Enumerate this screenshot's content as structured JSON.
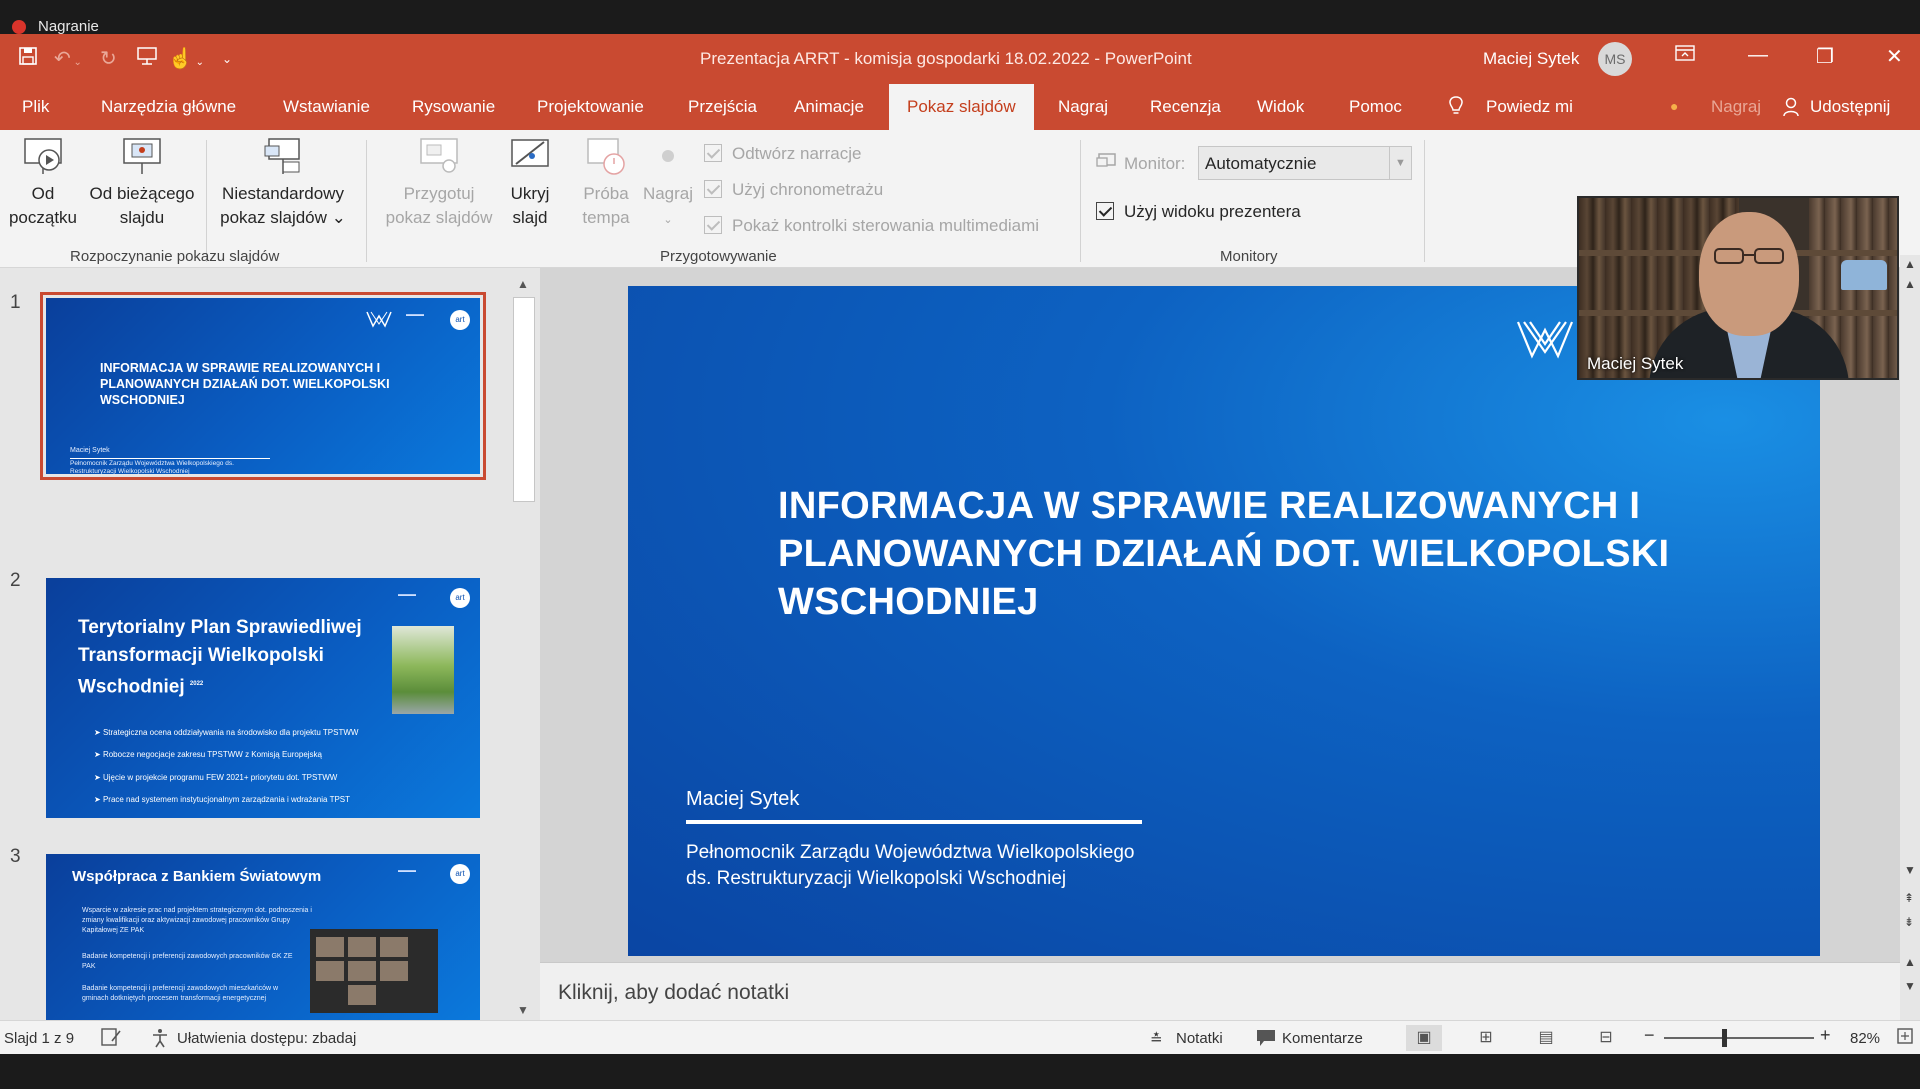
{
  "recording": {
    "label": "Nagranie"
  },
  "window": {
    "title": "Prezentacja ARRT - komisja gospodarki 18.02.2022  -  PowerPoint",
    "user_name": "Maciej Sytek",
    "user_initials": "MS"
  },
  "tabs": [
    {
      "label": "Plik"
    },
    {
      "label": "Narzędzia główne"
    },
    {
      "label": "Wstawianie"
    },
    {
      "label": "Rysowanie"
    },
    {
      "label": "Projektowanie"
    },
    {
      "label": "Przejścia"
    },
    {
      "label": "Animacje"
    },
    {
      "label": "Pokaz slajdów",
      "active": true
    },
    {
      "label": "Nagraj"
    },
    {
      "label": "Recenzja"
    },
    {
      "label": "Widok"
    },
    {
      "label": "Pomoc"
    }
  ],
  "tell_me": "Powiedz mi",
  "tab_right": {
    "record": "Nagraj",
    "share": "Udostępnij"
  },
  "ribbon": {
    "start_group": {
      "label": "Rozpoczynanie pokazu slajdów",
      "from_beginning": [
        "Od",
        "początku"
      ],
      "from_current": [
        "Od bieżącego",
        "slajdu"
      ],
      "custom": [
        "Niestandardowy",
        "pokaz slajdów ⌄"
      ]
    },
    "setup_group": {
      "label": "Przygotowywanie",
      "setup_show": [
        "Przygotuj",
        "pokaz slajdów"
      ],
      "hide_slide": [
        "Ukryj",
        "slajd"
      ],
      "rehearse": [
        "Próba",
        "tempa"
      ],
      "record": [
        "Nagraj",
        "⌄"
      ],
      "checks": [
        "Odtwórz narracje",
        "Użyj chronometrażu",
        "Pokaż kontrolki sterowania multimediami"
      ]
    },
    "monitors_group": {
      "label": "Monitory",
      "monitor_label": "Monitor:",
      "monitor_value": "Automatycznie",
      "presenter_view": "Użyj widoku prezentera"
    }
  },
  "thumbnails": [
    {
      "number": "1",
      "title": "INFORMACJA W SPRAWIE REALIZOWANYCH I PLANOWANYCH DZIAŁAŃ DOT. WIELKOPOLSKI WSCHODNIEJ",
      "author": "Maciej Sytek",
      "sub": "Pełnomocnik Zarządu Województwa Wielkopolskiego ds. Restrukturyzacji Wielkopolski Wschodniej"
    },
    {
      "number": "2",
      "title_lines": [
        "Terytorialny Plan Sprawiedliwej",
        "Transformacji Wielkopolski",
        "Wschodniej"
      ],
      "year": "2022",
      "bullets": [
        "Strategiczna ocena oddziaływania na środowisko dla projektu TPSTWW",
        "Robocze negocjacje zakresu TPSTWW z Komisją Europejską",
        "Ujęcie w projekcie programu FEW 2021+ priorytetu dot. TPSTWW",
        "Prace nad systemem instytucjonalnym zarządzania i wdrażania TPST"
      ]
    },
    {
      "number": "3",
      "title": "Współpraca z Bankiem Światowym",
      "bullets": [
        "Wsparcie w zakresie prac nad projektem strategicznym dot. podnoszenia i zmiany kwalifikacji oraz aktywizacji zawodowej pracowników Grupy Kapitałowej ZE PAK",
        "Badanie kompetencji i preferencji zawodowych pracowników GK ZE PAK",
        "Badanie kompetencji i preferencji zawodowych mieszkańców w gminach dotkniętych procesem transformacji energetycznej"
      ]
    }
  ],
  "slide": {
    "title_lines": [
      "INFORMACJA W SPRAWIE REALIZOWANYCH I",
      "PLANOWANYCH DZIAŁAŃ DOT. WIELKOPOLSKI",
      "WSCHODNIEJ"
    ],
    "author": "Maciej Sytek",
    "sub_lines": [
      "Pełnomocnik Zarządu Województwa Wielkopolskiego",
      "ds. Restrukturyzacji Wielkopolski Wschodniej"
    ]
  },
  "notes_placeholder": "Kliknij, aby dodać notatki",
  "webcam": {
    "name": "Maciej Sytek"
  },
  "status": {
    "slide_info": "Slajd 1 z 9",
    "accessibility": "Ułatwienia dostępu: zbadaj",
    "notes": "Notatki",
    "comments": "Komentarze",
    "zoom": "82%",
    "zoom_level": 0.82
  },
  "colors": {
    "accent": "#c94a31",
    "slide_blue": "#0a5dc2"
  }
}
